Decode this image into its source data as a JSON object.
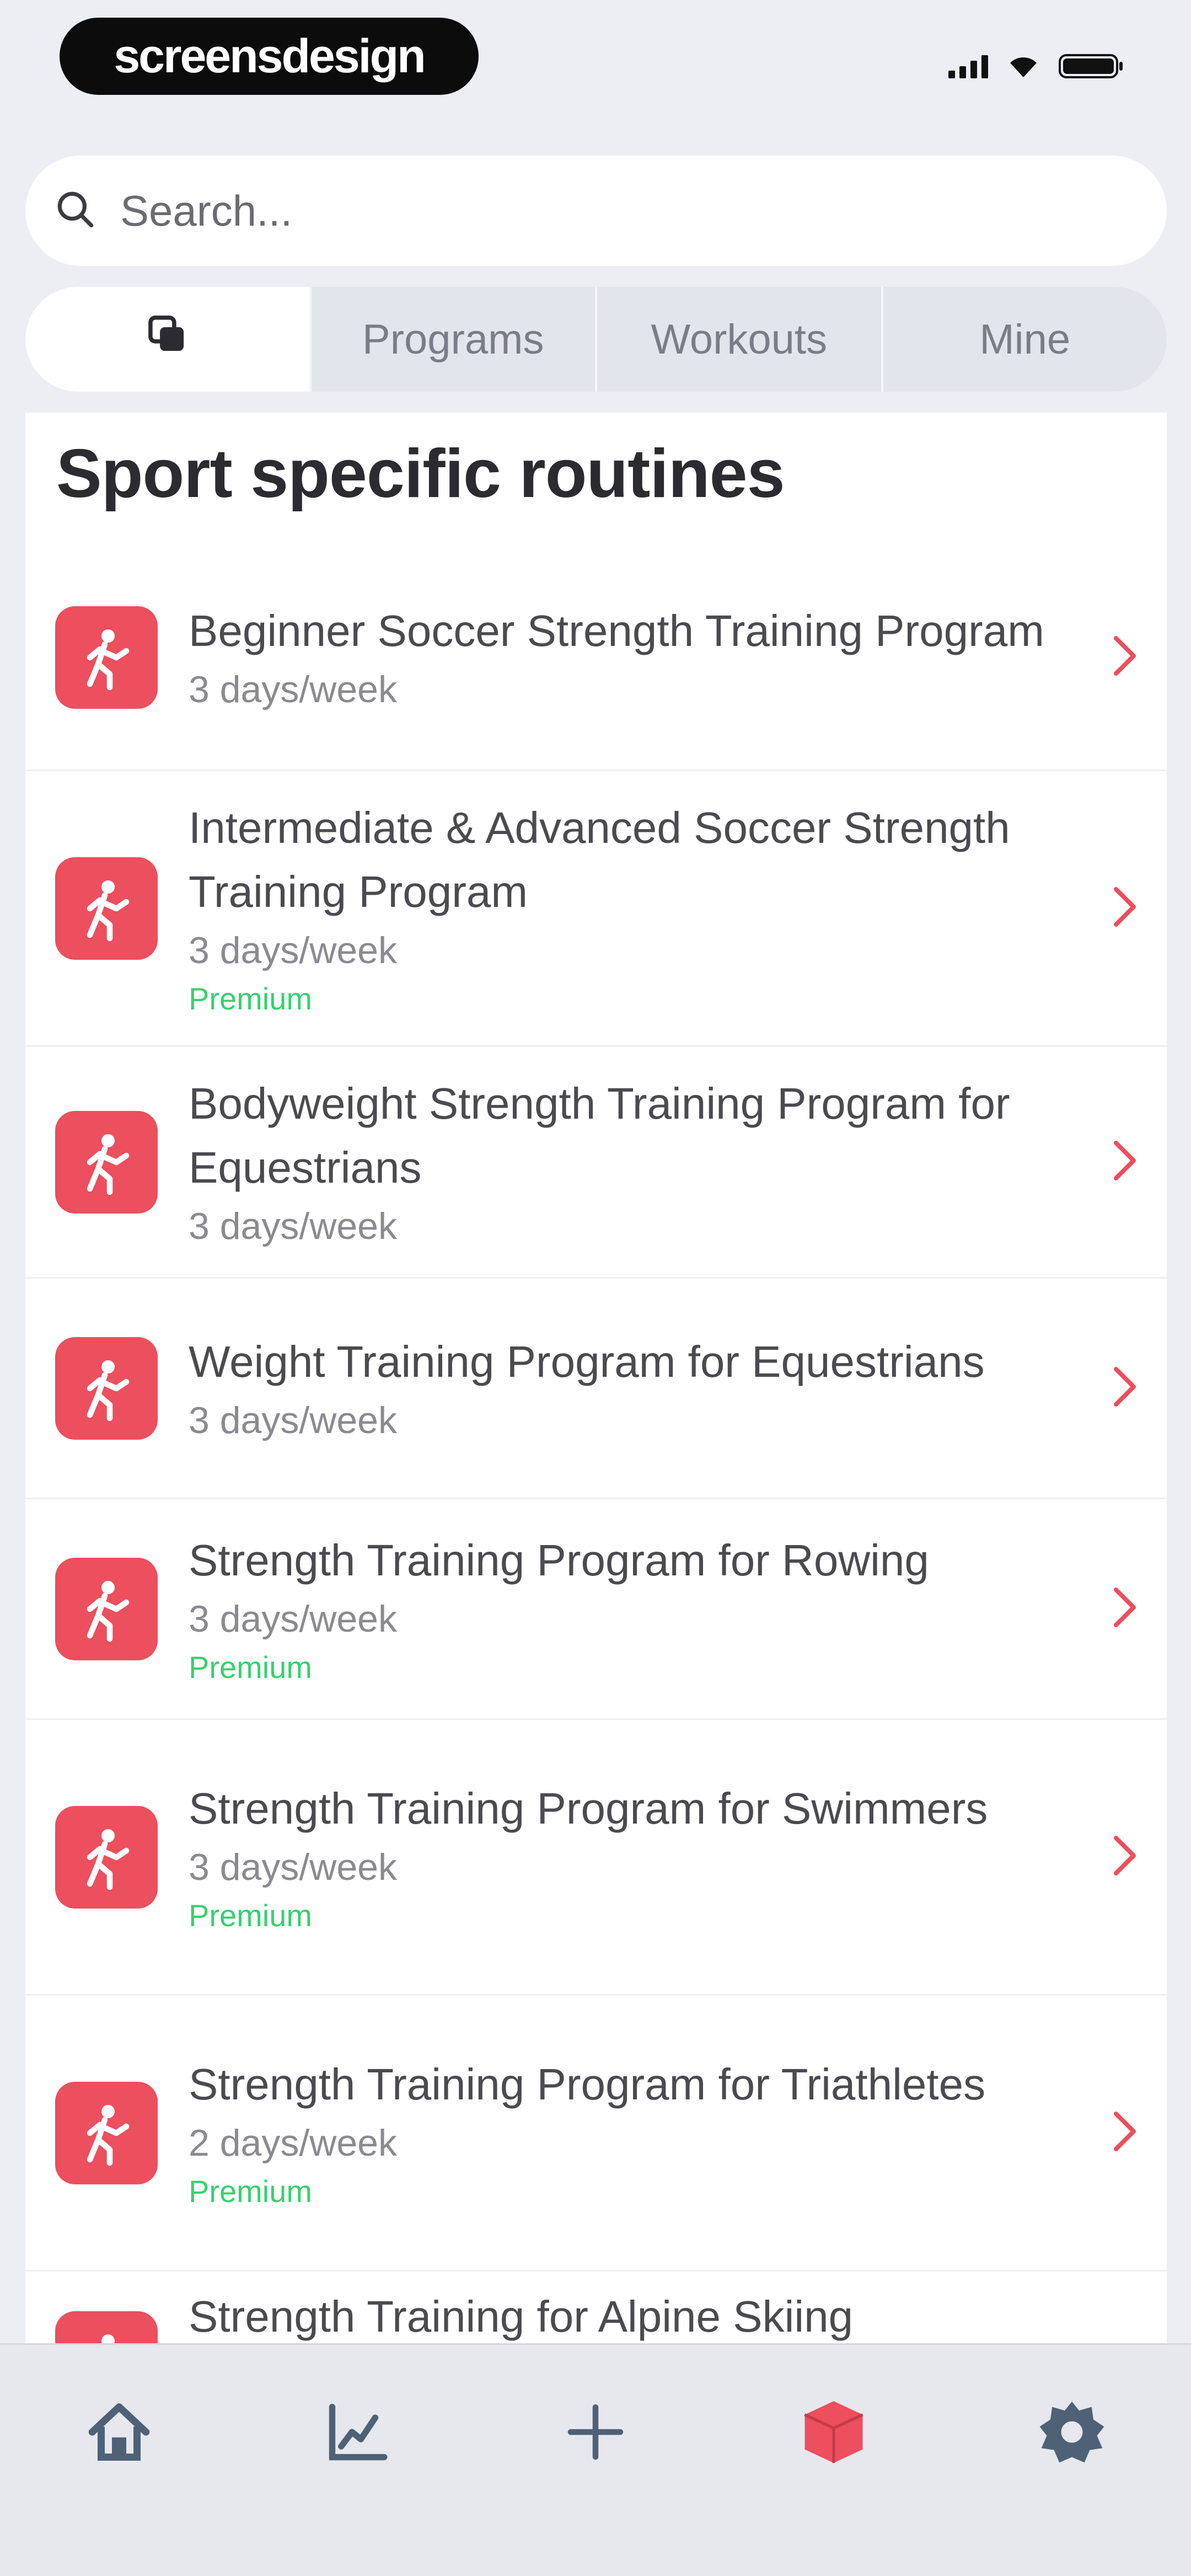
{
  "status_bar": {
    "brand": "screensdesign"
  },
  "search": {
    "placeholder": "Search..."
  },
  "tabs": [
    {
      "label": "",
      "icon": "copy-icon",
      "active": true
    },
    {
      "label": "Programs"
    },
    {
      "label": "Workouts"
    },
    {
      "label": "Mine"
    }
  ],
  "section": {
    "title": "Sport specific routines"
  },
  "routines": [
    {
      "title": "Beginner Soccer Strength Training Program",
      "frequency": "3 days/week",
      "premium": ""
    },
    {
      "title": "Intermediate & Advanced Soccer Strength Training Program",
      "frequency": "3 days/week",
      "premium": "Premium"
    },
    {
      "title": "Bodyweight Strength Training Program for Equestrians",
      "frequency": "3 days/week",
      "premium": ""
    },
    {
      "title": "Weight Training Program for Equestrians",
      "frequency": "3 days/week",
      "premium": ""
    },
    {
      "title": "Strength Training Program for Rowing",
      "frequency": "3 days/week",
      "premium": "Premium"
    },
    {
      "title": "Strength Training Program for Swimmers",
      "frequency": "3 days/week",
      "premium": "Premium"
    },
    {
      "title": "Strength Training Program for Triathletes",
      "frequency": "2 days/week",
      "premium": "Premium"
    },
    {
      "title": "Strength Training for Alpine Skiing",
      "frequency": "",
      "premium": ""
    }
  ],
  "bottom_nav": [
    {
      "icon": "home-icon"
    },
    {
      "icon": "chart-icon"
    },
    {
      "icon": "plus-icon"
    },
    {
      "icon": "cube-icon",
      "active": true
    },
    {
      "icon": "gear-icon"
    }
  ],
  "colors": {
    "accent": "#ec4f5e",
    "premium": "#36d16e",
    "nav_icon": "#4e6176"
  }
}
